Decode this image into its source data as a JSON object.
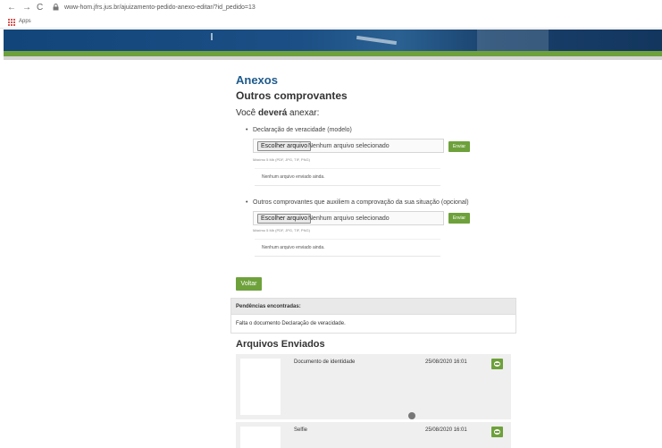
{
  "browser": {
    "url": "www-hom.jfrs.jus.br/ajuizamento-pedido-anexo-editar/?id_pedido=13",
    "bookmarks_label": "Apps"
  },
  "page": {
    "title": "Anexos",
    "subtitle": "Outros comprovantes",
    "instruction_prefix": "Você ",
    "instruction_bold": "deverá",
    "instruction_suffix": " anexar:"
  },
  "attachments": [
    {
      "label": "Declaração de veracidade (modelo)",
      "choose_button": "Escolher arquivo",
      "no_file": "Nenhum arquivo selecionado",
      "send_button": "Enviar",
      "max_size": "Máximo 5 Mb (PDF, JPG, TIF, PNG)",
      "sent_status": "Nenhum arquivo enviado ainda."
    },
    {
      "label": "Outros comprovantes que auxiliem a comprovação da sua situação (opcional)",
      "choose_button": "Escolher arquivo",
      "no_file": "Nenhum arquivo selecionado",
      "send_button": "Enviar",
      "max_size": "Máximo 5 Mb (PDF, JPG, TIF, PNG)",
      "sent_status": "Nenhum arquivo enviado ainda."
    }
  ],
  "back_button": "Voltar",
  "pending": {
    "header": "Pendências encontradas:",
    "message": "Falta o documento Declaração de veracidade."
  },
  "sent_files": {
    "title": "Arquivos Enviados",
    "items": [
      {
        "name": "Documento de identidade",
        "date": "25/08/2020 16:01"
      },
      {
        "name": "Selfie",
        "date": "25/08/2020 16:01"
      }
    ]
  },
  "colors": {
    "accent_green": "#6ea13b",
    "title_blue": "#1e5a8c",
    "header_blue": "#12467a"
  }
}
